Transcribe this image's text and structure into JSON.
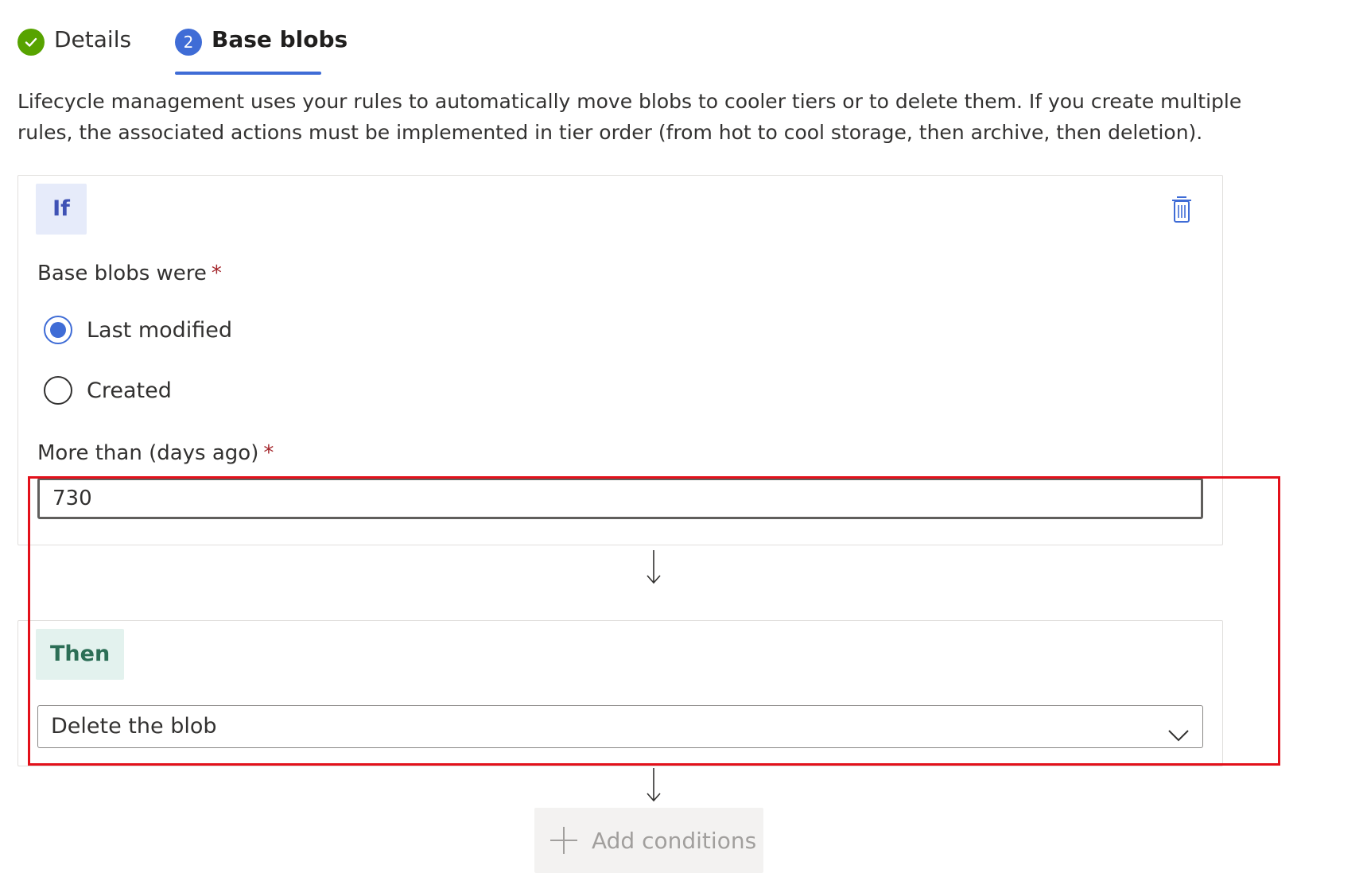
{
  "tabs": [
    {
      "label": "Details",
      "status": "complete"
    },
    {
      "label": "Base blobs",
      "number": "2",
      "active": true
    }
  ],
  "description": "Lifecycle management uses your rules to automatically move blobs to cooler tiers or to delete them. If you create multiple rules, the associated actions must be implemented in tier order (from hot to cool storage, then archive, then deletion).",
  "if_block": {
    "badge": "If",
    "base_blobs_label": "Base blobs were",
    "required_mark": "*",
    "options": [
      {
        "label": "Last modified",
        "selected": true
      },
      {
        "label": "Created",
        "selected": false
      }
    ],
    "days_label": "More than (days ago)",
    "days_value": "730"
  },
  "then_block": {
    "badge": "Then",
    "action_value": "Delete the blob"
  },
  "add_conditions_label": "Add conditions",
  "colors": {
    "accent": "#3f6cd6",
    "success": "#57a300",
    "highlight": "#e3101a"
  },
  "icons": [
    "check-icon",
    "trash-icon",
    "arrow-down-icon",
    "chevron-down-icon",
    "plus-icon"
  ]
}
